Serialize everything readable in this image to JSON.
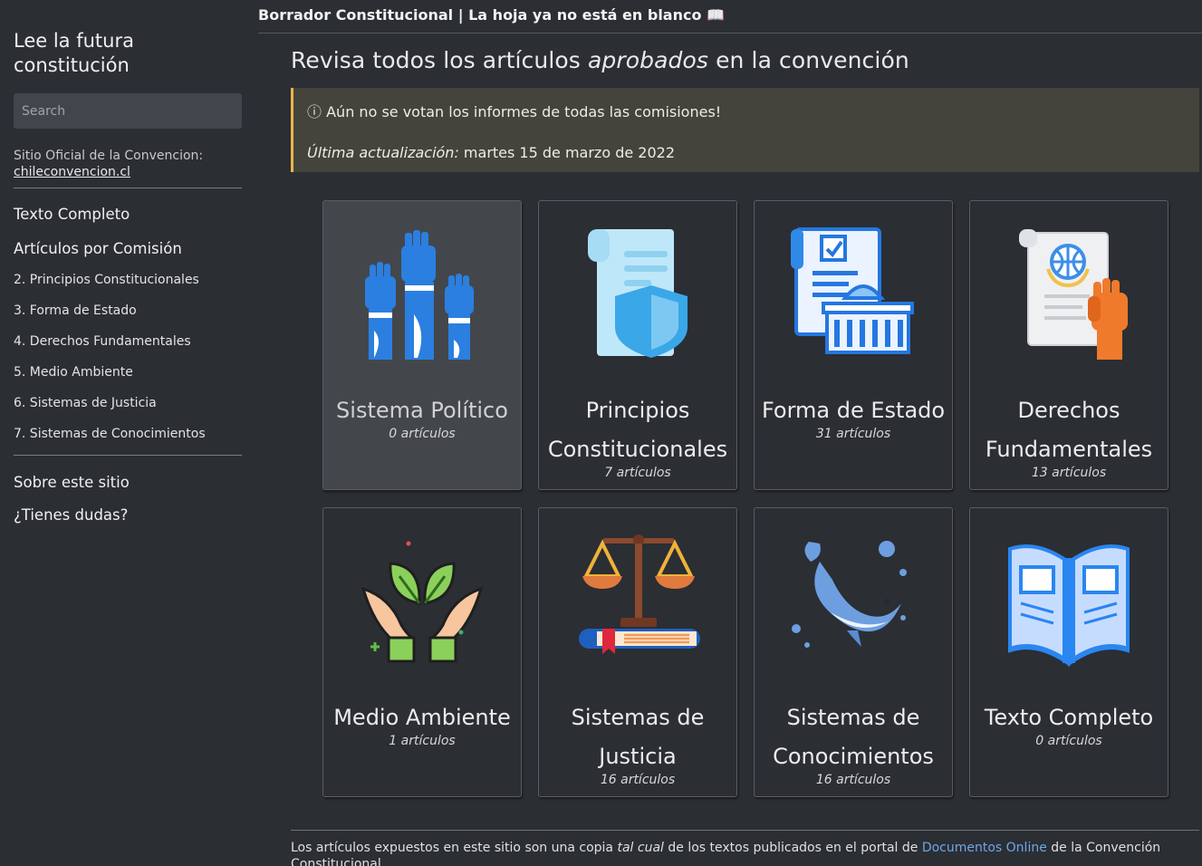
{
  "topbar": {
    "title": "Borrador Constitucional | La hoja ya no está en blanco",
    "emoji": "📖"
  },
  "sidebar": {
    "site_title": "Lee la futura constitución",
    "search_placeholder": "Search",
    "official_label": "Sitio Oficial de la Convencion:",
    "official_link": "chileconvencion.cl",
    "nav_full_text": "Texto Completo",
    "nav_by_commission": "Artículos por Comisión",
    "items": [
      "2. Principios Constitucionales",
      "3. Forma de Estado",
      "4. Derechos Fundamentales",
      "5. Medio Ambiente",
      "6. Sistemas de Justicia",
      "7. Sistemas de Conocimientos"
    ],
    "about": "Sobre este sitio",
    "questions": "¿Tienes dudas?"
  },
  "main": {
    "heading_pre": "Revisa todos los artículos",
    "heading_em": "aprobados",
    "heading_post": "en la convención",
    "notice_icon": "ⓘ",
    "notice_text": "Aún no se votan los informes de todas las comisiones!",
    "updated_label": "Última actualización:",
    "updated_date": "martes 15 de marzo de 2022"
  },
  "cards": [
    {
      "title": "Sistema Político",
      "count": "0 artículos",
      "icon": "raised-fists-icon"
    },
    {
      "title": "Principios Constitucionales",
      "count": "7 artículos",
      "icon": "scroll-shield-icon"
    },
    {
      "title": "Forma de Estado",
      "count": "31 artículos",
      "icon": "document-government-building-icon"
    },
    {
      "title": "Derechos Fundamentales",
      "count": "13 artículos",
      "icon": "scroll-globe-fist-icon"
    },
    {
      "title": "Medio Ambiente",
      "count": "1 artículos",
      "icon": "hands-leaves-icon"
    },
    {
      "title": "Sistemas de Justicia",
      "count": "16 artículos",
      "icon": "scales-book-icon"
    },
    {
      "title": "Sistemas de Conocimientos",
      "count": "16 artículos",
      "icon": "whale-icon"
    },
    {
      "title": "Texto Completo",
      "count": "0 artículos",
      "icon": "open-book-icon"
    }
  ],
  "footer": {
    "pre": "Los artículos expuestos en este sitio son una copia",
    "em": "tal cual",
    "mid": "de los textos publicados en el portal de",
    "link": "Documentos Online",
    "post": "de la Convención Constitucional"
  }
}
